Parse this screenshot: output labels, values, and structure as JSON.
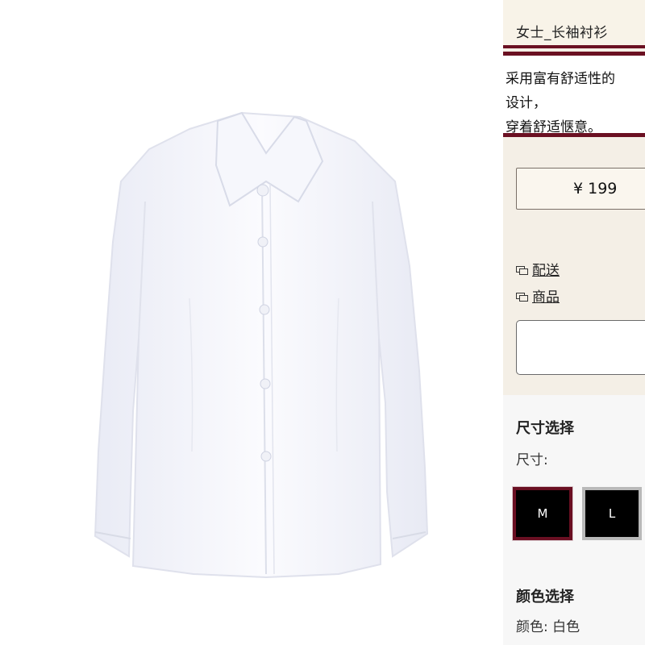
{
  "product": {
    "title": "女士_长袖衬衫",
    "description_lines": [
      "采用富有舒适性的",
      "设计，",
      "穿着舒适惬意。"
    ],
    "price": "¥ 199"
  },
  "links": [
    {
      "label": "配送",
      "icon": "message-icon"
    },
    {
      "label": "商品",
      "icon": "message-icon"
    }
  ],
  "size_section": {
    "title": "尺寸选择",
    "label": "尺寸:",
    "options": [
      "M",
      "L"
    ],
    "selected": "M"
  },
  "color_section": {
    "title": "颜色选择",
    "label": "颜色: 白色"
  },
  "colors": {
    "accent": "#6b1022",
    "panel_bg": "#f4efe6",
    "button_bg": "#000000"
  }
}
